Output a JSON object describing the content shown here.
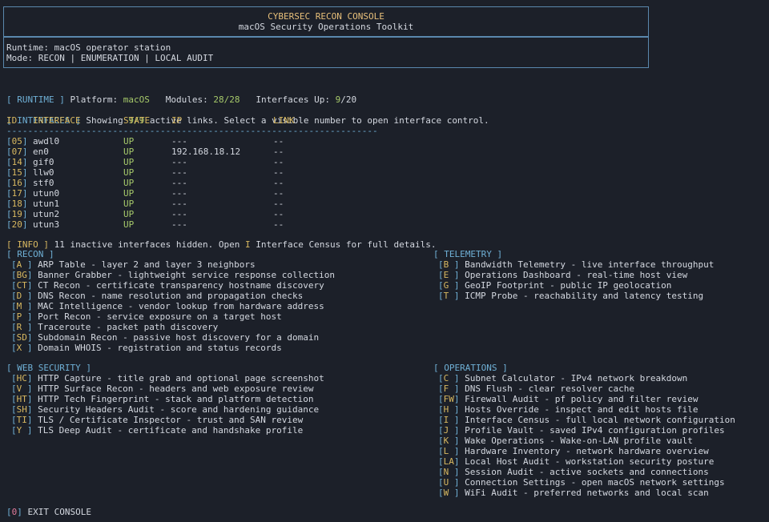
{
  "header": {
    "title": "CYBERSEC RECON CONSOLE",
    "subtitle": "macOS Security Operations Toolkit",
    "runtime": "Runtime: macOS operator station",
    "mode": "Mode: RECON | ENUMERATION | LOCAL AUDIT"
  },
  "status": {
    "tag": "[ RUNTIME ]",
    "platform_label": "Platform:",
    "platform": "macOS",
    "modules_label": "Modules:",
    "modules": "28/28",
    "interfaces_label": "Interfaces Up:",
    "interfaces_up": "9",
    "interfaces_total": "/20"
  },
  "interfaces": {
    "tag": "[ INTERFACES ]",
    "summary_pre": "Showing",
    "shown": "9/9",
    "summary_post": "active links. Select a visible number to open interface control.",
    "columns": [
      "ID",
      "INTERFACE",
      "STATE",
      "IP",
      "LINK"
    ],
    "divider": "----------------------------------------------------------------------",
    "rows": [
      {
        "id": "05",
        "name": "awdl0",
        "state": "UP",
        "ip": "---",
        "link": "--"
      },
      {
        "id": "07",
        "name": "en0",
        "state": "UP",
        "ip": "192.168.18.12",
        "link": "--"
      },
      {
        "id": "14",
        "name": "gif0",
        "state": "UP",
        "ip": "---",
        "link": "--"
      },
      {
        "id": "15",
        "name": "llw0",
        "state": "UP",
        "ip": "---",
        "link": "--"
      },
      {
        "id": "16",
        "name": "stf0",
        "state": "UP",
        "ip": "---",
        "link": "--"
      },
      {
        "id": "17",
        "name": "utun0",
        "state": "UP",
        "ip": "---",
        "link": "--"
      },
      {
        "id": "18",
        "name": "utun1",
        "state": "UP",
        "ip": "---",
        "link": "--"
      },
      {
        "id": "19",
        "name": "utun2",
        "state": "UP",
        "ip": "---",
        "link": "--"
      },
      {
        "id": "20",
        "name": "utun3",
        "state": "UP",
        "ip": "---",
        "link": "--"
      }
    ],
    "info_tag": "[ INFO ]",
    "info_pre": "11 inactive interfaces hidden. Open",
    "info_key": "I",
    "info_post": "Interface Census for full details."
  },
  "recon": {
    "tag": "[ RECON ]",
    "items": [
      {
        "key": "A ",
        "label": "ARP Table - layer 2 and layer 3 neighbors"
      },
      {
        "key": "BG",
        "label": "Banner Grabber - lightweight service response collection"
      },
      {
        "key": "CT",
        "label": "CT Recon - certificate transparency hostname discovery"
      },
      {
        "key": "D ",
        "label": "DNS Recon - name resolution and propagation checks"
      },
      {
        "key": "M ",
        "label": "MAC Intelligence - vendor lookup from hardware address"
      },
      {
        "key": "P ",
        "label": "Port Recon - service exposure on a target host"
      },
      {
        "key": "R ",
        "label": "Traceroute - packet path discovery"
      },
      {
        "key": "SD",
        "label": "Subdomain Recon - passive host discovery for a domain"
      },
      {
        "key": "X ",
        "label": "Domain WHOIS - registration and status records"
      }
    ]
  },
  "telemetry": {
    "tag": "[ TELEMETRY ]",
    "items": [
      {
        "key": "B ",
        "label": "Bandwidth Telemetry - live interface throughput"
      },
      {
        "key": "E ",
        "label": "Operations Dashboard - real-time host view"
      },
      {
        "key": "G ",
        "label": "GeoIP Footprint - public IP geolocation"
      },
      {
        "key": "T ",
        "label": "ICMP Probe - reachability and latency testing"
      }
    ]
  },
  "web_security": {
    "tag": "[ WEB SECURITY ]",
    "items": [
      {
        "key": "HC",
        "label": "HTTP Capture - title grab and optional page screenshot"
      },
      {
        "key": "V ",
        "label": "HTTP Surface Recon - headers and web exposure review"
      },
      {
        "key": "HT",
        "label": "HTTP Tech Fingerprint - stack and platform detection"
      },
      {
        "key": "SH",
        "label": "Security Headers Audit - score and hardening guidance"
      },
      {
        "key": "TI",
        "label": "TLS / Certificate Inspector - trust and SAN review"
      },
      {
        "key": "Y ",
        "label": "TLS Deep Audit - certificate and handshake profile"
      }
    ]
  },
  "operations": {
    "tag": "[ OPERATIONS ]",
    "items": [
      {
        "key": "C ",
        "label": "Subnet Calculator - IPv4 network breakdown"
      },
      {
        "key": "F ",
        "label": "DNS Flush - clear resolver cache"
      },
      {
        "key": "FW",
        "label": "Firewall Audit - pf policy and filter review"
      },
      {
        "key": "H ",
        "label": "Hosts Override - inspect and edit hosts file"
      },
      {
        "key": "I ",
        "label": "Interface Census - full local network configuration"
      },
      {
        "key": "J ",
        "label": "Profile Vault - saved IPv4 configuration profiles"
      },
      {
        "key": "K ",
        "label": "Wake Operations - Wake-on-LAN profile vault"
      },
      {
        "key": "L ",
        "label": "Hardware Inventory - network hardware overview"
      },
      {
        "key": "LA",
        "label": "Local Host Audit - workstation security posture"
      },
      {
        "key": "N ",
        "label": "Session Audit - active sockets and connections"
      },
      {
        "key": "U ",
        "label": "Connection Settings - open macOS network settings"
      },
      {
        "key": "W ",
        "label": "WiFi Audit - preferred networks and local scan"
      }
    ]
  },
  "exit": {
    "key": "0",
    "label": "EXIT CONSOLE"
  }
}
